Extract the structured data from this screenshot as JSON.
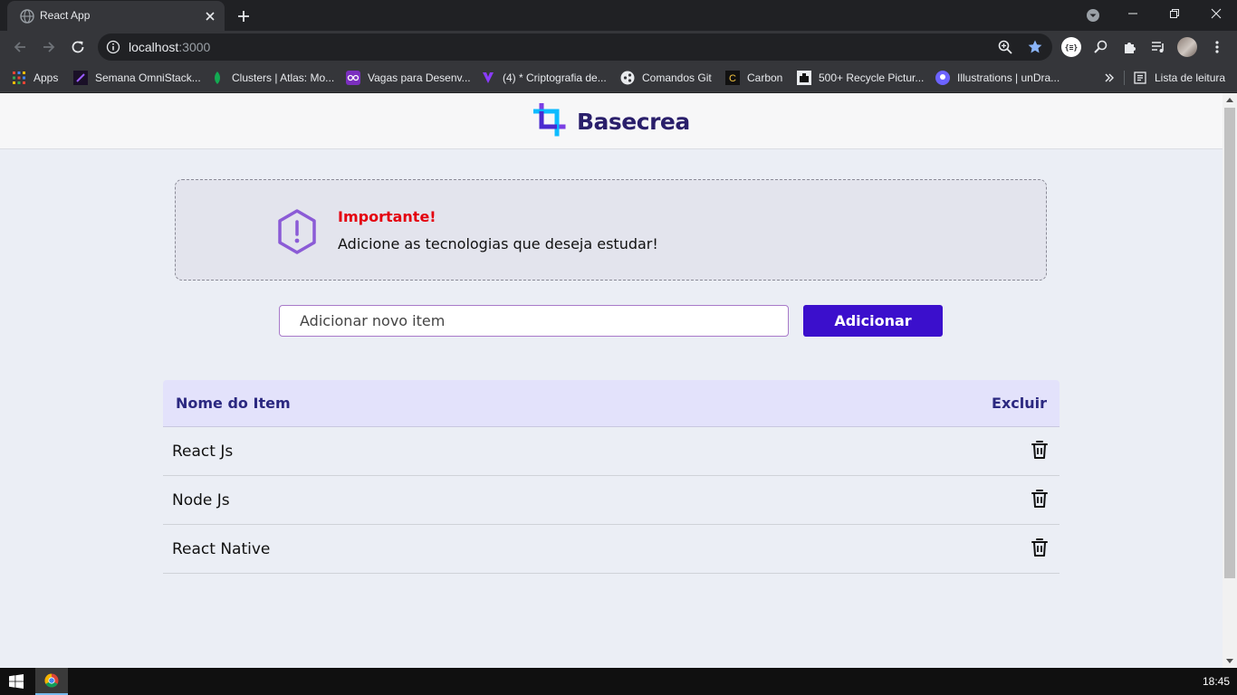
{
  "browser": {
    "tab_title": "React App",
    "url_host": "localhost",
    "url_port": ":3000",
    "bookmarks": [
      "Apps",
      "Semana OmniStack...",
      "Clusters | Atlas: Mo...",
      "Vagas para Desenv...",
      "(4) * Criptografia de...",
      "Comandos Git",
      "Carbon",
      "500+ Recycle Pictur...",
      "Illustrations | unDra..."
    ],
    "reading_list": "Lista de leitura",
    "extension_label": "{≡}"
  },
  "page": {
    "logo_text": "Basecrea",
    "notice": {
      "title": "Importante!",
      "text": "Adicione as tecnologias que deseja estudar!"
    },
    "form": {
      "placeholder": "Adicionar novo item",
      "button_label": "Adicionar"
    },
    "table": {
      "headers": {
        "name": "Nome do Item",
        "delete": "Excluir"
      },
      "rows": [
        "React Js",
        "Node Js",
        "React Native"
      ]
    }
  },
  "taskbar": {
    "clock": "18:45"
  },
  "colors": {
    "accent": "#3b0fcc",
    "notice_title": "#e4000f",
    "header_text": "#2b2880",
    "logo_purple": "#7b3fe4",
    "logo_cyan": "#00b7ff"
  }
}
